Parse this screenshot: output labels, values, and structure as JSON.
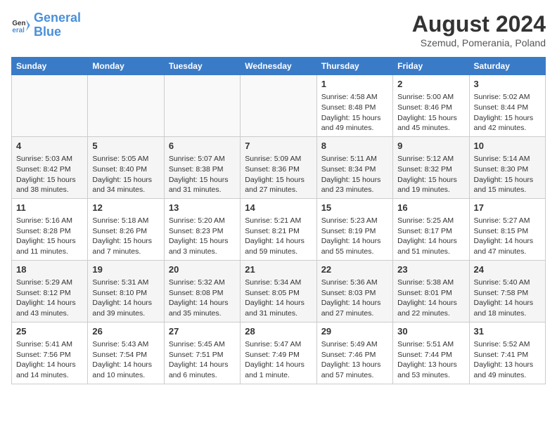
{
  "header": {
    "logo_line1": "General",
    "logo_line2": "Blue",
    "month_year": "August 2024",
    "location": "Szemud, Pomerania, Poland"
  },
  "days_of_week": [
    "Sunday",
    "Monday",
    "Tuesday",
    "Wednesday",
    "Thursday",
    "Friday",
    "Saturday"
  ],
  "weeks": [
    [
      {
        "day": "",
        "content": ""
      },
      {
        "day": "",
        "content": ""
      },
      {
        "day": "",
        "content": ""
      },
      {
        "day": "",
        "content": ""
      },
      {
        "day": "1",
        "content": "Sunrise: 4:58 AM\nSunset: 8:48 PM\nDaylight: 15 hours and 49 minutes."
      },
      {
        "day": "2",
        "content": "Sunrise: 5:00 AM\nSunset: 8:46 PM\nDaylight: 15 hours and 45 minutes."
      },
      {
        "day": "3",
        "content": "Sunrise: 5:02 AM\nSunset: 8:44 PM\nDaylight: 15 hours and 42 minutes."
      }
    ],
    [
      {
        "day": "4",
        "content": "Sunrise: 5:03 AM\nSunset: 8:42 PM\nDaylight: 15 hours and 38 minutes."
      },
      {
        "day": "5",
        "content": "Sunrise: 5:05 AM\nSunset: 8:40 PM\nDaylight: 15 hours and 34 minutes."
      },
      {
        "day": "6",
        "content": "Sunrise: 5:07 AM\nSunset: 8:38 PM\nDaylight: 15 hours and 31 minutes."
      },
      {
        "day": "7",
        "content": "Sunrise: 5:09 AM\nSunset: 8:36 PM\nDaylight: 15 hours and 27 minutes."
      },
      {
        "day": "8",
        "content": "Sunrise: 5:11 AM\nSunset: 8:34 PM\nDaylight: 15 hours and 23 minutes."
      },
      {
        "day": "9",
        "content": "Sunrise: 5:12 AM\nSunset: 8:32 PM\nDaylight: 15 hours and 19 minutes."
      },
      {
        "day": "10",
        "content": "Sunrise: 5:14 AM\nSunset: 8:30 PM\nDaylight: 15 hours and 15 minutes."
      }
    ],
    [
      {
        "day": "11",
        "content": "Sunrise: 5:16 AM\nSunset: 8:28 PM\nDaylight: 15 hours and 11 minutes."
      },
      {
        "day": "12",
        "content": "Sunrise: 5:18 AM\nSunset: 8:26 PM\nDaylight: 15 hours and 7 minutes."
      },
      {
        "day": "13",
        "content": "Sunrise: 5:20 AM\nSunset: 8:23 PM\nDaylight: 15 hours and 3 minutes."
      },
      {
        "day": "14",
        "content": "Sunrise: 5:21 AM\nSunset: 8:21 PM\nDaylight: 14 hours and 59 minutes."
      },
      {
        "day": "15",
        "content": "Sunrise: 5:23 AM\nSunset: 8:19 PM\nDaylight: 14 hours and 55 minutes."
      },
      {
        "day": "16",
        "content": "Sunrise: 5:25 AM\nSunset: 8:17 PM\nDaylight: 14 hours and 51 minutes."
      },
      {
        "day": "17",
        "content": "Sunrise: 5:27 AM\nSunset: 8:15 PM\nDaylight: 14 hours and 47 minutes."
      }
    ],
    [
      {
        "day": "18",
        "content": "Sunrise: 5:29 AM\nSunset: 8:12 PM\nDaylight: 14 hours and 43 minutes."
      },
      {
        "day": "19",
        "content": "Sunrise: 5:31 AM\nSunset: 8:10 PM\nDaylight: 14 hours and 39 minutes."
      },
      {
        "day": "20",
        "content": "Sunrise: 5:32 AM\nSunset: 8:08 PM\nDaylight: 14 hours and 35 minutes."
      },
      {
        "day": "21",
        "content": "Sunrise: 5:34 AM\nSunset: 8:05 PM\nDaylight: 14 hours and 31 minutes."
      },
      {
        "day": "22",
        "content": "Sunrise: 5:36 AM\nSunset: 8:03 PM\nDaylight: 14 hours and 27 minutes."
      },
      {
        "day": "23",
        "content": "Sunrise: 5:38 AM\nSunset: 8:01 PM\nDaylight: 14 hours and 22 minutes."
      },
      {
        "day": "24",
        "content": "Sunrise: 5:40 AM\nSunset: 7:58 PM\nDaylight: 14 hours and 18 minutes."
      }
    ],
    [
      {
        "day": "25",
        "content": "Sunrise: 5:41 AM\nSunset: 7:56 PM\nDaylight: 14 hours and 14 minutes."
      },
      {
        "day": "26",
        "content": "Sunrise: 5:43 AM\nSunset: 7:54 PM\nDaylight: 14 hours and 10 minutes."
      },
      {
        "day": "27",
        "content": "Sunrise: 5:45 AM\nSunset: 7:51 PM\nDaylight: 14 hours and 6 minutes."
      },
      {
        "day": "28",
        "content": "Sunrise: 5:47 AM\nSunset: 7:49 PM\nDaylight: 14 hours and 1 minute."
      },
      {
        "day": "29",
        "content": "Sunrise: 5:49 AM\nSunset: 7:46 PM\nDaylight: 13 hours and 57 minutes."
      },
      {
        "day": "30",
        "content": "Sunrise: 5:51 AM\nSunset: 7:44 PM\nDaylight: 13 hours and 53 minutes."
      },
      {
        "day": "31",
        "content": "Sunrise: 5:52 AM\nSunset: 7:41 PM\nDaylight: 13 hours and 49 minutes."
      }
    ]
  ]
}
